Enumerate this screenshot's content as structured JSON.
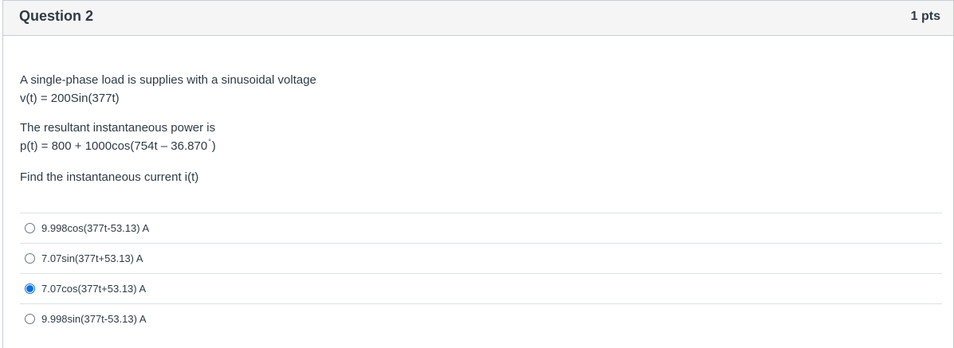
{
  "question": {
    "title": "Question 2",
    "points": "1 pts",
    "body": {
      "line1": "A single-phase load is supplies with a sinusoidal voltage",
      "line2": "v(t) = 200Sin(377t)",
      "line3": "The resultant instantaneous power is",
      "line4_pre": "p(t) = 800 + 1000cos(754t – 36.870",
      "line4_degree": "°",
      "line4_post": ")",
      "line5": "Find the instantaneous current i(t)"
    },
    "answers": [
      {
        "label": "9.998cos(377t-53.13) A",
        "selected": false
      },
      {
        "label": "7.07sin(377t+53.13) A",
        "selected": false
      },
      {
        "label": "7.07cos(377t+53.13) A",
        "selected": true
      },
      {
        "label": "9.998sin(377t-53.13) A",
        "selected": false
      }
    ]
  },
  "colors": {
    "accent": "#0e70d6",
    "text": "#2d3b45",
    "header_bg": "#f5f5f5",
    "border": "#c7cdd1"
  }
}
